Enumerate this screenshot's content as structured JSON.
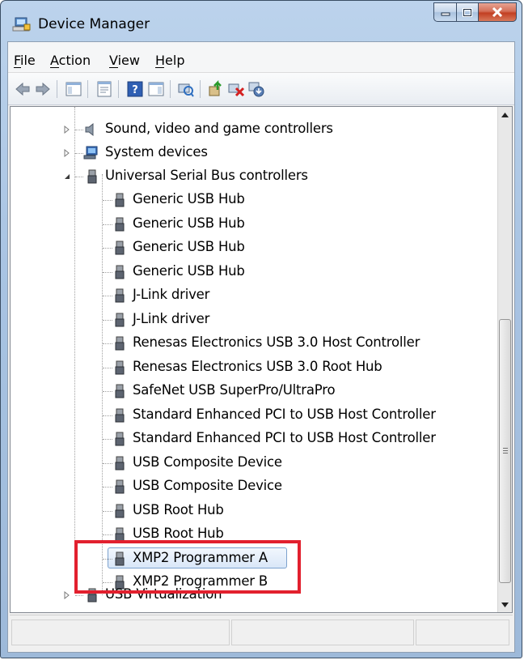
{
  "window": {
    "title": "Device Manager"
  },
  "menu": [
    {
      "label": "File"
    },
    {
      "label": "Action"
    },
    {
      "label": "View"
    },
    {
      "label": "Help"
    }
  ],
  "toolbar": {
    "buttons": [
      "back-icon",
      "forward-icon",
      "show-hide-console-tree-icon",
      "properties-icon",
      "help-icon",
      "action-pane-icon",
      "scan-hardware-icon",
      "update-driver-icon",
      "uninstall-icon",
      "disable-icon"
    ]
  },
  "tree": {
    "categories": [
      {
        "label": "Sound, video and game controllers",
        "expanded": false
      },
      {
        "label": "System devices",
        "expanded": false
      },
      {
        "label": "Universal Serial Bus controllers",
        "expanded": true
      },
      {
        "label": "USB Virtualization",
        "expanded": false
      }
    ],
    "usb_children": [
      "Generic USB Hub",
      "Generic USB Hub",
      "Generic USB Hub",
      "Generic USB Hub",
      "J-Link driver",
      "J-Link driver",
      "Renesas Electronics USB 3.0 Host Controller",
      "Renesas Electronics USB 3.0 Root Hub",
      "SafeNet USB SuperPro/UltraPro",
      "Standard Enhanced PCI to USB Host Controller",
      "Standard Enhanced PCI to USB Host Controller",
      "USB Composite Device",
      "USB Composite Device",
      "USB Root Hub",
      "USB Root Hub",
      "XMP2 Programmer A",
      "XMP2 Programmer B"
    ],
    "selected": "XMP2 Programmer A"
  },
  "colors": {
    "highlight": "#e2202e",
    "selection": "#d9e7f8"
  }
}
